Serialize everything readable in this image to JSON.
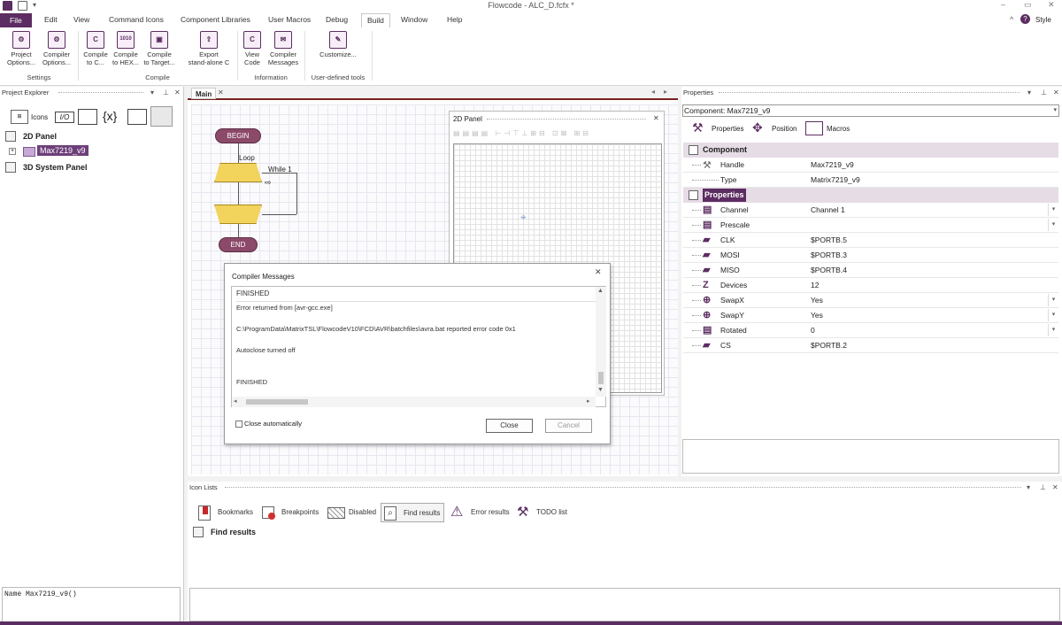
{
  "window": {
    "title": "Flowcode - ALC_D.fcfx *",
    "style_label": "Style"
  },
  "menu": {
    "items": [
      "File",
      "Edit",
      "View",
      "Command Icons",
      "Component Libraries",
      "User Macros",
      "Debug",
      "Build",
      "Window",
      "Help"
    ],
    "active": "Build"
  },
  "ribbon": {
    "buttons": [
      {
        "line1": "Project",
        "line2": "Options...",
        "icon": "gear-icon"
      },
      {
        "line1": "Compiler",
        "line2": "Options...",
        "icon": "gears-icon"
      },
      {
        "line1": "Compile",
        "line2": "to C...",
        "icon": "c-file-icon"
      },
      {
        "line1": "Compile",
        "line2": "to HEX...",
        "icon": "binary-icon"
      },
      {
        "line1": "Compile",
        "line2": "to Target...",
        "icon": "chip-icon"
      },
      {
        "line1": "Export",
        "line2": "stand-alone C",
        "icon": "export-icon"
      },
      {
        "line1": "View",
        "line2": "Code",
        "icon": "view-code-icon"
      },
      {
        "line1": "Compiler",
        "line2": "Messages",
        "icon": "messages-icon"
      },
      {
        "line1": "Customize...",
        "line2": "",
        "icon": "pencil-icon"
      }
    ],
    "groups": [
      "Settings",
      "Compile",
      "Information",
      "User-defined tools"
    ]
  },
  "project_explorer": {
    "title": "Project Explorer",
    "icons_label": "Icons",
    "tree": [
      "2D Panel",
      "Max7219_v9",
      "3D System Panel"
    ],
    "footer": "Name Max7219_v9()"
  },
  "main_tab": {
    "label": "Main",
    "flowchart": {
      "begin": "BEGIN",
      "loop": "Loop",
      "while": "While 1",
      "end": "END"
    }
  },
  "panel_2d": {
    "title": "2D Panel"
  },
  "compiler_dialog": {
    "title": "Compiler Messages",
    "lines": [
      "FINISHED",
      "Error returned from [avr-gcc.exe]",
      "C:\\ProgramData\\MatrixTSL\\FlowcodeV10\\FCD\\AVR\\batchfiles\\avra.bat reported error code 0x1",
      "Autoclose turned off",
      "FINISHED"
    ],
    "checkbox_label": "Close automatically",
    "close_button": "Close",
    "cancel_button": "Cancel"
  },
  "properties": {
    "title": "Properties",
    "component_select": "Component: Max7219_v9",
    "tabs": [
      "Properties",
      "Position",
      "Macros"
    ],
    "component_section": "Component",
    "component_rows": [
      {
        "name": "Handle",
        "value": "Max7219_v9"
      },
      {
        "name": "Type",
        "value": "Matrix7219_v9"
      }
    ],
    "properties_section": "Properties",
    "property_rows": [
      {
        "name": "Channel",
        "value": "Channel 1",
        "dropdown": "▾",
        "icon": "list-icon"
      },
      {
        "name": "Prescale",
        "value": "",
        "dropdown": "▾",
        "icon": "list-icon"
      },
      {
        "name": "CLK",
        "value": "$PORTB.5",
        "dropdown": "",
        "icon": "pin-icon"
      },
      {
        "name": "MOSI",
        "value": "$PORTB.3",
        "dropdown": "",
        "icon": "pin-icon"
      },
      {
        "name": "MISO",
        "value": "$PORTB.4",
        "dropdown": "",
        "icon": "pin-icon"
      },
      {
        "name": "Devices",
        "value": "12",
        "dropdown": "",
        "icon": "z-icon"
      },
      {
        "name": "SwapX",
        "value": "Yes",
        "dropdown": "▾",
        "icon": "toggle-icon"
      },
      {
        "name": "SwapY",
        "value": "Yes",
        "dropdown": "▾",
        "icon": "toggle-icon"
      },
      {
        "name": "Rotated",
        "value": "0",
        "dropdown": "▾",
        "icon": "list-icon"
      },
      {
        "name": "CS",
        "value": "$PORTB.2",
        "dropdown": "",
        "icon": "pin-icon"
      }
    ]
  },
  "icon_lists": {
    "title": "Icon Lists",
    "tabs": [
      "Bookmarks",
      "Breakpoints",
      "Disabled",
      "Find results",
      "Error results",
      "TODO list"
    ],
    "active_tab": "Find results",
    "content_heading": "Find results"
  },
  "colors": {
    "accent": "#5c2d62",
    "category_bg": "#e6dce6",
    "flow_yellow": "#f2d35c",
    "terminal": "#8c4a6a"
  }
}
